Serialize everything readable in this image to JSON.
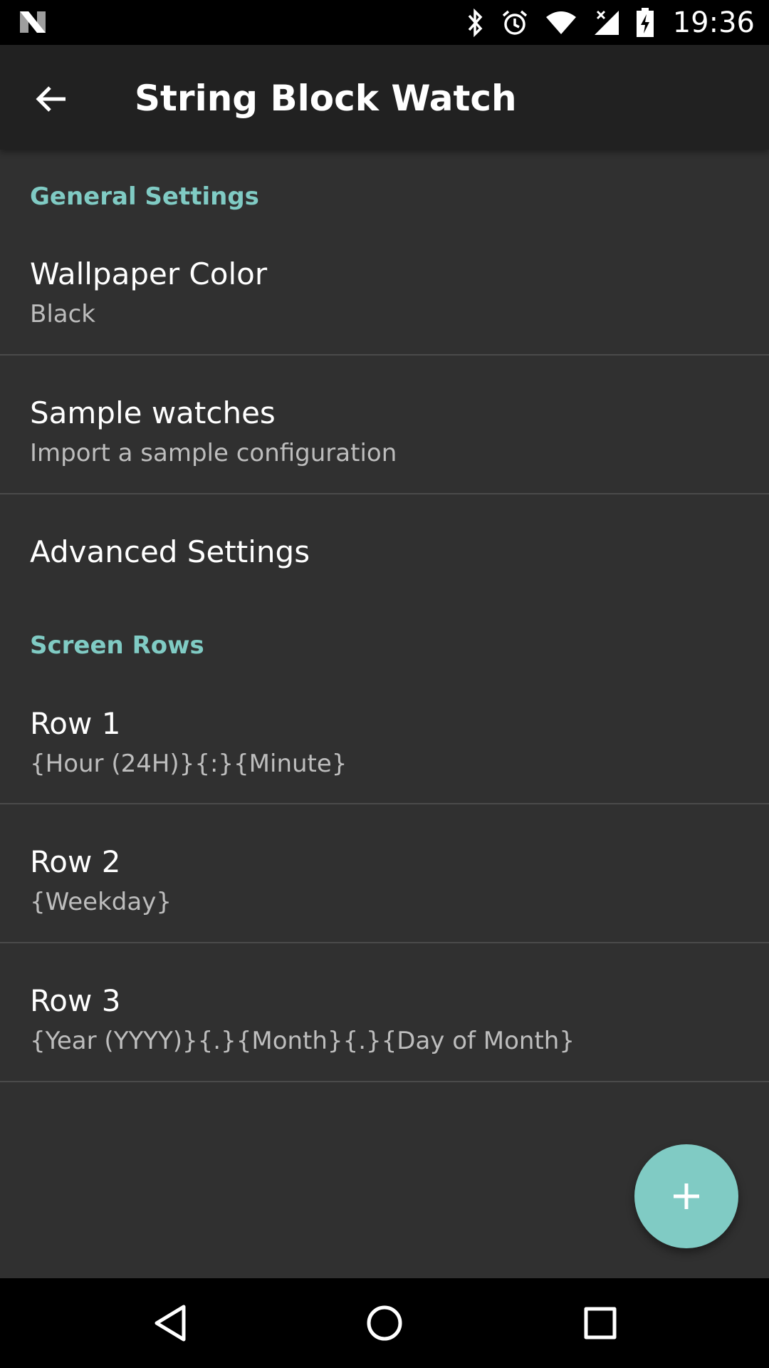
{
  "status_bar": {
    "time": "19:36",
    "icons": [
      "notification-n-icon",
      "bluetooth-icon",
      "alarm-icon",
      "wifi-icon",
      "signal-icon",
      "battery-charging-icon"
    ]
  },
  "app_bar": {
    "title": "String Block Watch",
    "back_icon": "arrow-back-icon"
  },
  "sections": {
    "general": {
      "header": "General Settings",
      "items": [
        {
          "title": "Wallpaper Color",
          "summary": "Black"
        },
        {
          "title": "Sample watches",
          "summary": "Import a sample configuration"
        },
        {
          "title": "Advanced Settings"
        }
      ]
    },
    "screen_rows": {
      "header": "Screen Rows",
      "items": [
        {
          "title": "Row 1",
          "summary": "{Hour (24H)}{:}{Minute}"
        },
        {
          "title": "Row 2",
          "summary": "{Weekday}"
        },
        {
          "title": "Row 3",
          "summary": "{Year (YYYY)}{.}{Month}{.}{Day of Month}"
        }
      ]
    }
  },
  "fab": {
    "icon": "add-icon"
  },
  "nav_bar": {
    "icons": [
      "back-triangle-icon",
      "home-circle-icon",
      "recents-square-icon"
    ]
  },
  "colors": {
    "accent": "#80cbc4",
    "background": "#303030",
    "app_bar": "#212121"
  }
}
